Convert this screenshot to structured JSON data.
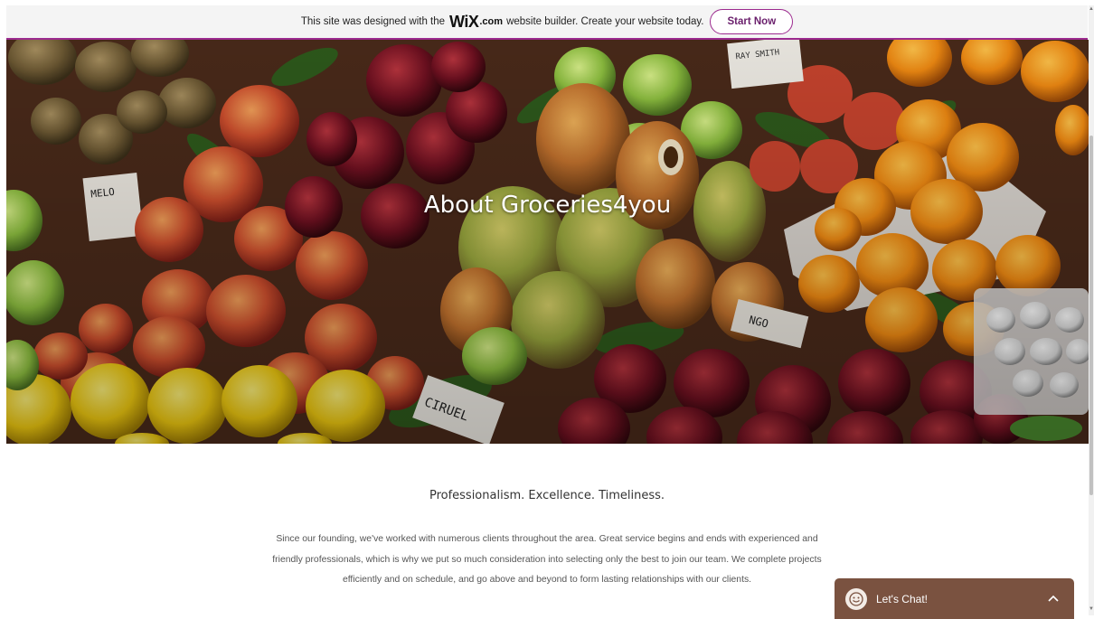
{
  "wix_banner": {
    "text_before": "This site was designed with the",
    "logo": "WiX",
    "logo_suffix": ".com",
    "text_after": "website builder. Create your website today.",
    "cta_label": "Start Now",
    "accent_color": "#9c2b8f"
  },
  "hero": {
    "title": "About Groceries4you",
    "image_description_icon": "fruit-market-photo"
  },
  "about": {
    "tagline": "Professionalism. Excellence. Timeliness.",
    "body": "Since our founding, we've worked with numerous clients throughout the area. Great service begins and ends with experienced and friendly professionals, which is why we put so much consideration into selecting only the best to join our team. We complete projects efficiently and on schedule, and go above and beyond to form lasting relationships with our clients."
  },
  "chat": {
    "label": "Let's Chat!",
    "icon": "smiley-icon",
    "chevron_icon": "chevron-up-icon",
    "bg_color": "#7a5240"
  }
}
